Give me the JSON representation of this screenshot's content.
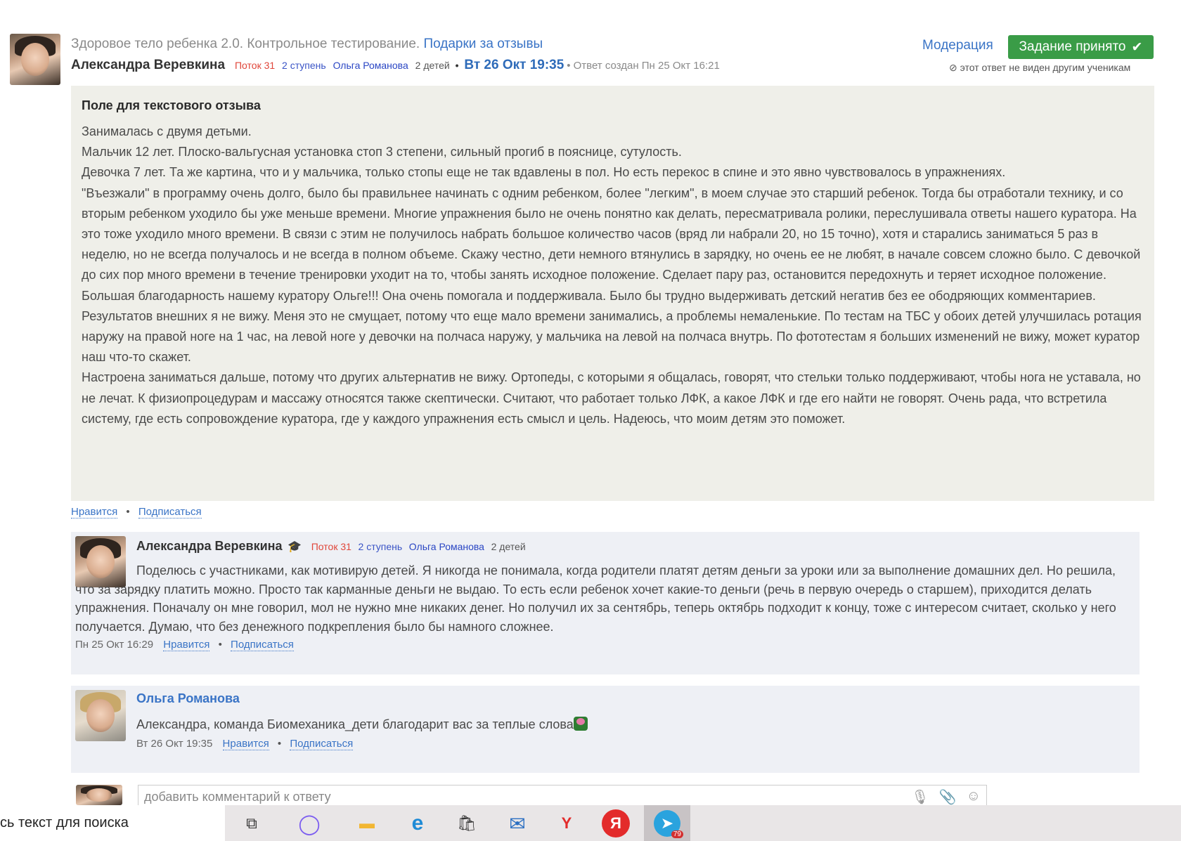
{
  "post": {
    "course": "Здоровое тело ребенка 2.0. Контрольное тестирование.",
    "course_link": "Подарки за отзывы",
    "author": "Александра Веревкина",
    "stream": "Поток 31",
    "level": "2 ступень",
    "curator": "Ольга Романова",
    "kids": "2 детей",
    "bullet": "•",
    "date": "Вт 26 Окт 19:35",
    "created": "• Ответ создан Пн 25 Окт 16:21",
    "moderation": "Модерация",
    "status_button": "Задание принято",
    "status_check": "✔",
    "hidden_note": "этот ответ не виден другим ученикам",
    "hidden_icon": "⊘"
  },
  "review": {
    "title": "Поле для текстового отзыва",
    "paragraphs": [
      "Занималась с двумя детьми.",
      "Мальчик 12 лет. Плоско-вальгусная установка стоп 3 степени, сильный прогиб в пояснице, сутулость.",
      "Девочка 7 лет. Та же картина, что и у мальчика, только стопы еще не так вдавлены в пол. Но есть перекос в спине и это явно чувствовалось в упражнениях.",
      "\"Въезжали\" в программу очень долго, было бы правильнее начинать с одним ребенком, более \"легким\", в моем случае это старший ребенок. Тогда бы отработали технику, и со вторым ребенком уходило бы уже меньше времени. Многие упражнения было не очень понятно как делать, пересматривала ролики, переслушивала ответы нашего куратора. На это тоже уходило много времени. В связи с этим не получилось набрать большое количество часов (вряд ли набрали 20, но 15 точно), хотя и старались заниматься 5 раз в неделю, но не всегда получалось и не всегда в полном объеме. Скажу честно, дети немного втянулись в зарядку, но очень ее не любят, в начале совсем сложно было. С девочкой до сих пор много времени в течение тренировки уходит на то, чтобы занять исходное положение. Сделает пару раз, остановится передохнуть и теряет исходное положение.",
      "Большая благодарность нашему куратору Ольге!!! Она очень помогала и поддерживала. Было бы трудно выдерживать детский негатив без ее ободряющих комментариев.",
      "Результатов внешних я не вижу. Меня это не смущает, потому что еще мало времени занимались, а проблемы немаленькие. По тестам на ТБС у обоих детей улучшилась ротация наружу на правой ноге на 1 час, на левой ноге у девочки на полчаса наружу, у мальчика на левой на полчаса внутрь. По фототестам я больших изменений не вижу, может куратор наш что-то скажет.",
      "Настроена заниматься дальше, потому что других альтернатив не вижу. Ортопеды, с которыми я общалась, говорят, что стельки только поддерживают, чтобы нога не уставала, но не лечат. К физиопроцедурам и массажу относятся также скептически. Считают, что работает только ЛФК, а какое ЛФК и где его найти не говорят. Очень рада, что встретила систему, где есть сопровождение куратора, где у каждого упражнения есть смысл и цель. Надеюсь, что моим детям это поможет."
    ]
  },
  "actions": {
    "like": "Нравится",
    "subscribe": "Подписаться",
    "sep": "•"
  },
  "comment1": {
    "author": "Александра Веревкина",
    "stream": "Поток 31",
    "level": "2 ступень",
    "curator": "Ольга Романова",
    "kids": "2 детей",
    "text": "Поделюсь с участниками, как мотивирую детей. Я никогда не понимала, когда родители платят детям деньги за уроки или за выполнение домашних дел. Но решила, что за зарядку платить можно. Просто так карманные деньги не выдаю. То есть если ребенок хочет какие-то деньги (речь в первую очередь о старшем), приходится делать упражнения. Поначалу он мне говорил, мол не нужно мне никаких денег. Но получил их за сентябрь, теперь октябрь подходит к концу, тоже с интересом считает, сколько у него получается. Думаю, что без денежного подкрепления было бы намного сложнее.",
    "time": "Пн 25 Окт 16:29"
  },
  "comment2": {
    "author": "Ольга Романова",
    "text": "Александра, команда Биомеханика_дети благодарит вас за теплые слова",
    "time": "Вт 26 Окт 19:35"
  },
  "add_comment": {
    "placeholder": "добавить комментарий к ответу",
    "mic": "🎙",
    "clip": "📎",
    "smile": "☺"
  },
  "taskbar": {
    "search_text": "сь текст для поиска",
    "telegram_badge": "79",
    "icons": {
      "task_view": "⧉",
      "cortana": "◯",
      "explorer": "▬",
      "edge": "e",
      "store": "🛍",
      "mail": "✉",
      "yandex_browser": "Y",
      "yandex": "Я",
      "telegram": "➤"
    }
  }
}
